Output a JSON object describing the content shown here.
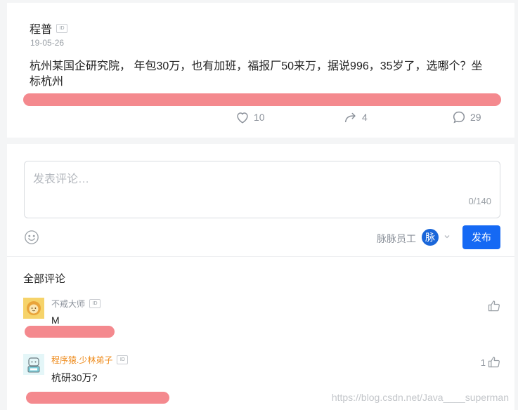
{
  "post": {
    "author": "程普",
    "id_badge": "ID",
    "date": "19-05-26",
    "text": "杭州某国企研究院， 年包30万，也有加班，福报厂50来万，据说996，35岁了，选哪个？坐标杭州",
    "likes": "10",
    "shares": "4",
    "comments": "29"
  },
  "editor": {
    "placeholder": "发表评论…",
    "char_count": "0/140",
    "identity_label": "脉脉员工",
    "identity_avatar_char": "脉",
    "publish_label": "发布"
  },
  "comments_section": {
    "title": "全部评论",
    "items": [
      {
        "name": "不戒大师",
        "id_badge": "ID",
        "text": "M",
        "like_count": "",
        "avatar": "lion-avatar-icon"
      },
      {
        "name": "程序猿.少林弟子",
        "id_badge": "ID",
        "text": "杭研30万?",
        "like_count": "1",
        "avatar": "robot-avatar-icon"
      }
    ]
  },
  "watermark": "https://blog.csdn.net/Java____superman",
  "colors": {
    "accent": "#1569f4",
    "redaction": "#f4898e",
    "muted": "#8a9099",
    "orange_name": "#ee8a1a"
  }
}
